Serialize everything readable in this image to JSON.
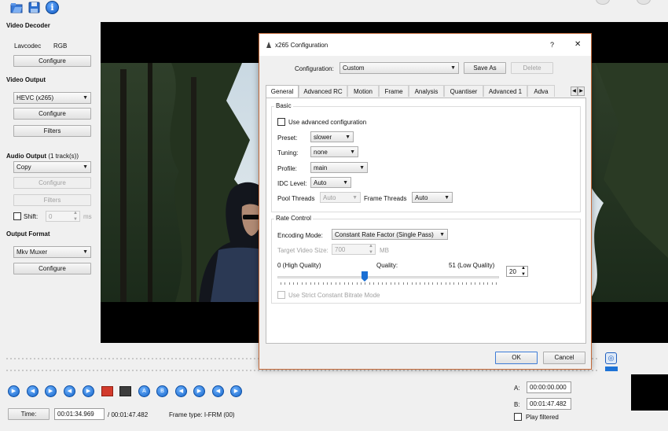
{
  "toolbar": {
    "icons": [
      "open-folder-icon",
      "save-disk-icon",
      "info-icon"
    ]
  },
  "left_panel": {
    "video_decoder": {
      "title": "Video Decoder",
      "codec_name": "Lavcodec",
      "codec_format": "RGB",
      "configure_label": "Configure"
    },
    "video_output": {
      "title": "Video Output",
      "codec": "HEVC (x265)",
      "configure_label": "Configure",
      "filters_label": "Filters"
    },
    "audio_output": {
      "title": "Audio Output",
      "track_info": "(1 track(s))",
      "codec": "Copy",
      "configure_label": "Configure",
      "filters_label": "Filters",
      "shift_label": "Shift:",
      "shift_value": "0",
      "shift_unit": "ms"
    },
    "output_format": {
      "title": "Output Format",
      "muxer": "Mkv Muxer",
      "configure_label": "Configure"
    }
  },
  "dialog": {
    "title": "x265 Configuration",
    "help": "?",
    "close": "✕",
    "configuration_label": "Configuration:",
    "configuration_value": "Custom",
    "save_as_label": "Save As",
    "delete_label": "Delete",
    "tabs": [
      "General",
      "Advanced RC",
      "Motion",
      "Frame",
      "Analysis",
      "Quantiser",
      "Advanced 1",
      "Adva"
    ],
    "active_tab": "General",
    "basic": {
      "title": "Basic",
      "use_advanced_label": "Use advanced configuration",
      "preset_label": "Preset:",
      "preset_value": "slower",
      "tuning_label": "Tuning:",
      "tuning_value": "none",
      "profile_label": "Profile:",
      "profile_value": "main",
      "idc_label": "IDC Level:",
      "idc_value": "Auto",
      "pool_threads_label": "Pool Threads",
      "pool_threads_value": "Auto",
      "frame_threads_label": "Frame Threads",
      "frame_threads_value": "Auto"
    },
    "rate_control": {
      "title": "Rate Control",
      "encoding_mode_label": "Encoding Mode:",
      "encoding_mode_value": "Constant Rate Factor (Single Pass)",
      "target_size_label": "Target Video Size:",
      "target_size_value": "700",
      "target_size_unit": "MB",
      "quality_min_label": "0 (High Quality)",
      "quality_label": "Quality:",
      "quality_max_label": "51 (Low Quality)",
      "quality_value": "20",
      "quality_fraction": 0.39,
      "strict_cbr_label": "Use Strict Constant Bitrate Mode"
    },
    "ok_label": "OK",
    "cancel_label": "Cancel"
  },
  "transport": {
    "buttons": [
      "play-icon",
      "rewind-icon",
      "forward-icon",
      "prev-frame-icon",
      "next-frame-icon",
      "record-icon",
      "segment-icon",
      "mark-a-icon",
      "mark-b-icon",
      "prev-key-icon",
      "next-key-icon",
      "prev-black-icon",
      "next-black-icon",
      "first-frame-icon",
      "last-frame-icon"
    ]
  },
  "status": {
    "time_label": "Time:",
    "current_time": "00:01:34.969",
    "total_time": "/ 00:01:47.482",
    "frame_type": "Frame type: I-FRM (00)",
    "a_label": "A:",
    "a_value": "00:00:00.000",
    "b_label": "B:",
    "b_value": "00:01:47.482",
    "play_filtered_label": "Play filtered"
  }
}
